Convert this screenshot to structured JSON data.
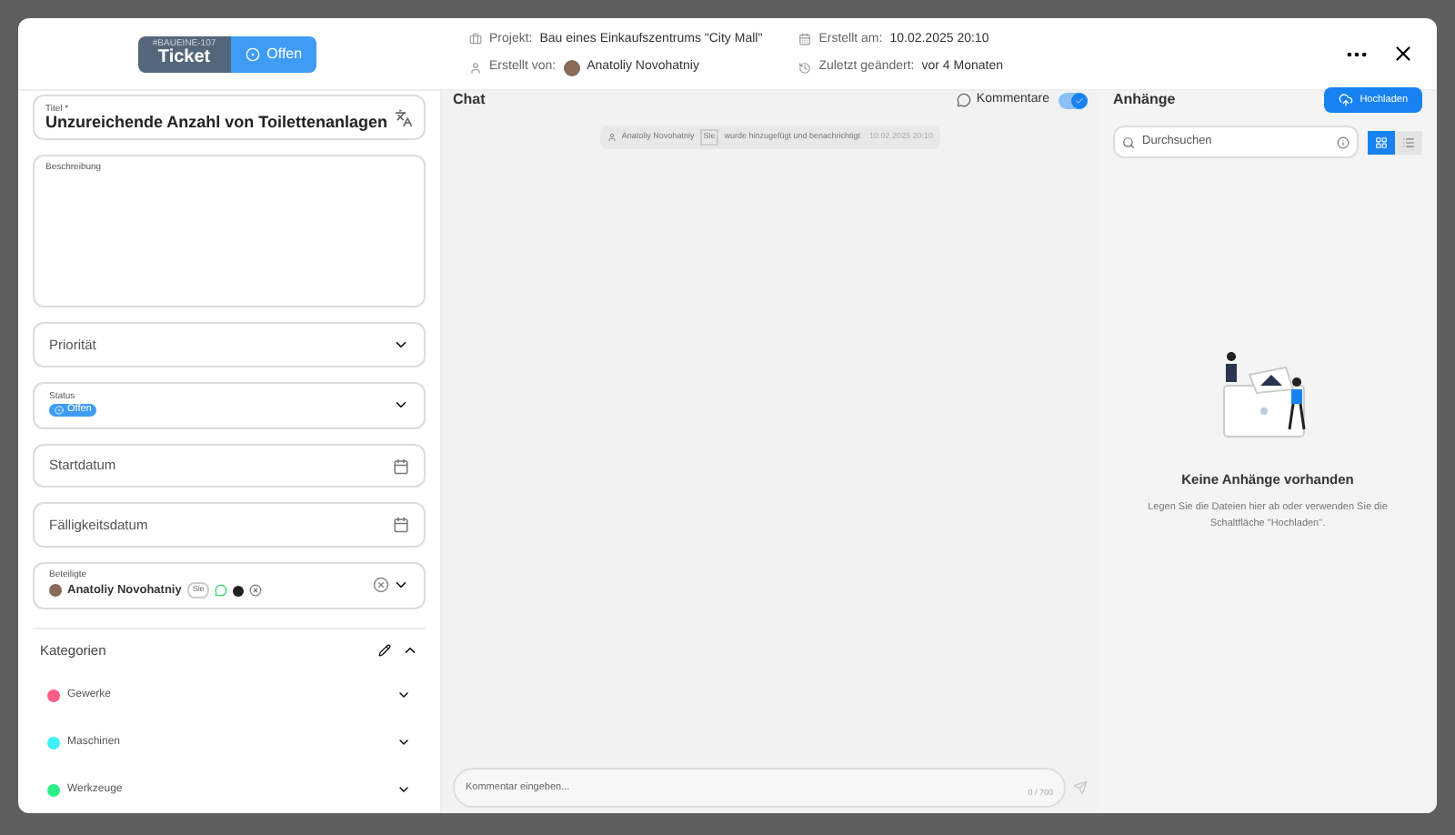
{
  "header": {
    "ticket_code": "#BAUEINE-107",
    "ticket_label": "Ticket",
    "status": "Offen",
    "project_label": "Projekt:",
    "project": "Bau eines Einkaufszentrums \"City Mall\"",
    "created_by_label": "Erstellt von:",
    "created_by": "Anatoliy Novohatniy",
    "created_at_label": "Erstellt am:",
    "created_at": "10.02.2025 20:10",
    "changed_label": "Zuletzt geändert:",
    "changed": "vor 4 Monaten"
  },
  "form": {
    "title_label": "Titel *",
    "title": "Unzureichende Anzahl von Toilettenanlagen",
    "description_label": "Beschreibung",
    "priority_placeholder": "Priorität",
    "status_label": "Status",
    "status": "Offen",
    "start_placeholder": "Startdatum",
    "due_placeholder": "Fälligkeitsdatum",
    "participants_label": "Beteiligte",
    "participants": [
      {
        "name": "Anatoliy Novohatniy",
        "tag": "Sie"
      }
    ],
    "categories_title": "Kategorien",
    "categories_expanded": true,
    "categories": [
      {
        "name": "Gewerke",
        "color": "#ff5c8a"
      },
      {
        "name": "Maschinen",
        "color": "#3ef0f5"
      },
      {
        "name": "Werkzeuge",
        "color": "#2ef08a"
      }
    ]
  },
  "chat": {
    "title": "Chat",
    "comments_label": "Kommentare",
    "comments_on": true,
    "events": [
      {
        "user": "Anatoliy Novohatniy",
        "tag": "Sie",
        "text": "wurde hinzugefügt und benachrichtigt",
        "time": "10.02.2025 20:10"
      }
    ],
    "input_placeholder": "Kommentar eingeben...",
    "counter": "0 / 700"
  },
  "attachments": {
    "title": "Anhänge",
    "upload": "Hochladen",
    "search_placeholder": "Durchsuchen",
    "views": [
      {
        "kind": "grid",
        "selected": true
      },
      {
        "kind": "list",
        "selected": false
      }
    ],
    "empty_title": "Keine Anhänge vorhanden",
    "empty_text": "Legen Sie die Dateien hier ab oder verwenden Sie die Schaltfläche \"Hochladen\"."
  }
}
